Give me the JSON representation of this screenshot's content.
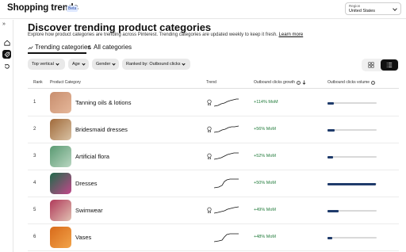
{
  "app": {
    "title": "Shopping trends",
    "badge": "Beta"
  },
  "region": {
    "label": "Region",
    "value": "United States"
  },
  "page": {
    "title": "Discover trending product categories",
    "description": "Explore how product categories are trending across Pinterest. Trending categories are updated weekly to keep it fresh.",
    "learn_more": "Learn more"
  },
  "tabs": [
    {
      "label": "Trending categories",
      "active": true
    },
    {
      "label": "All categories",
      "active": false
    }
  ],
  "filters": [
    "Top vertical",
    "Age",
    "Gender",
    "Ranked by: Outbound clicks"
  ],
  "table": {
    "headers": {
      "rank": "Rank",
      "category": "Product Category",
      "trend": "Trend",
      "growth": "Outbound clicks growth",
      "volume": "Outbound clicks volume"
    },
    "rows": [
      {
        "rank": "1",
        "name": "Tanning oils & lotions",
        "growth": "+114% MoM",
        "volume": 0.13,
        "seasonal": true,
        "thumb": [
          "#c88e6e",
          "#e5b79a"
        ]
      },
      {
        "rank": "2",
        "name": "Bridesmaid dresses",
        "growth": "+56% MoM",
        "volume": 0.15,
        "seasonal": true,
        "thumb": [
          "#a06a3a",
          "#d9c2a4"
        ]
      },
      {
        "rank": "3",
        "name": "Artificial flora",
        "growth": "+52% MoM",
        "volume": 0.12,
        "seasonal": true,
        "thumb": [
          "#5a9a72",
          "#b9d6c1"
        ]
      },
      {
        "rank": "4",
        "name": "Dresses",
        "growth": "+50% MoM",
        "volume": 0.98,
        "seasonal": false,
        "thumb": [
          "#1f6a4a",
          "#c2478a"
        ]
      },
      {
        "rank": "5",
        "name": "Swimwear",
        "growth": "+49% MoM",
        "volume": 0.22,
        "seasonal": true,
        "thumb": [
          "#b03a5a",
          "#e1c0b2"
        ]
      },
      {
        "rank": "6",
        "name": "Vases",
        "growth": "+48% MoM",
        "volume": 0.1,
        "seasonal": false,
        "thumb": [
          "#d86a1a",
          "#f2a44a"
        ]
      }
    ]
  },
  "icons": {
    "expand": "expand-sidebar-icon",
    "home": "home-icon",
    "trends": "trends-tag-icon",
    "history": "history-icon",
    "grid_view": "grid-view-icon",
    "list_view": "list-view-icon",
    "seasonal": "seasonal-badge-icon",
    "sort": "sort-down-arrow-icon"
  },
  "colors": {
    "growth": "#1f7a39",
    "volume_fill": "#1f3b6b",
    "volume_track": "#d9d9d9"
  }
}
